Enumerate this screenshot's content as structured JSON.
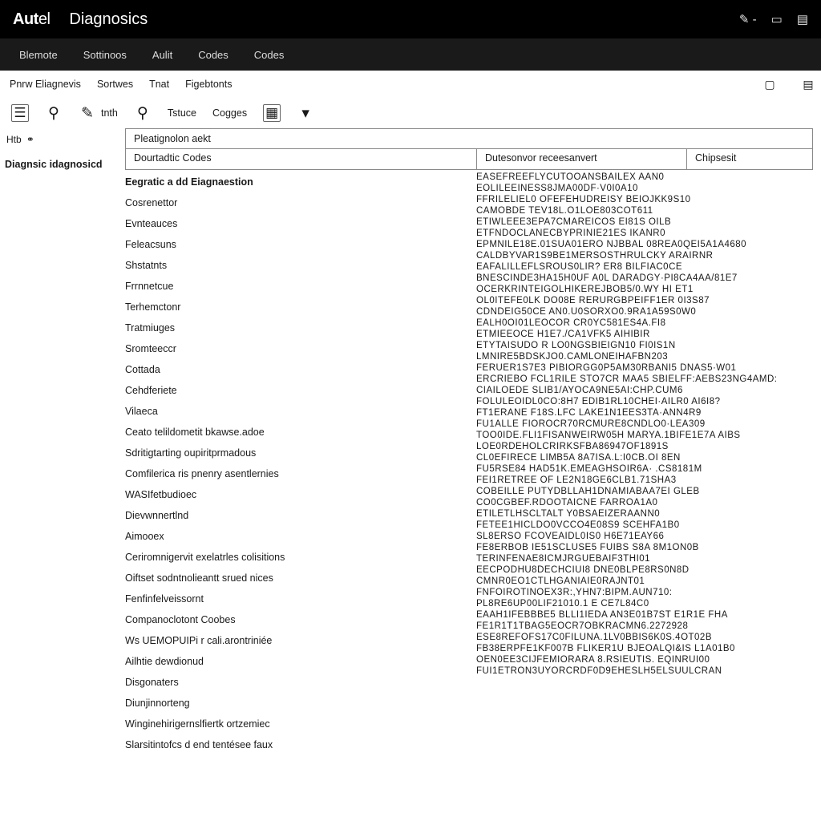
{
  "header": {
    "brand_bold": "Aut",
    "brand_light": "el",
    "title": "Diagnosics",
    "icons": [
      "✎ -",
      "▭",
      "▤"
    ]
  },
  "main_nav": [
    "Blemote",
    "Sottinoos",
    "Aulit",
    "Codes",
    "Codes"
  ],
  "sub_header": {
    "items": [
      "Pnrw Eliagnevis",
      "Sortwes",
      "Tnat",
      "Figebtonts"
    ],
    "right_icons": [
      "▢",
      "▤"
    ]
  },
  "toolbar": [
    {
      "icon": "☰",
      "label": "",
      "border": true
    },
    {
      "icon": "⚲",
      "label": "",
      "border": false
    },
    {
      "icon": "✎",
      "label": "tnth",
      "border": false
    },
    {
      "icon": "⚲",
      "label": "",
      "border": false
    },
    {
      "icon": "",
      "label": "Tstuce",
      "border": false
    },
    {
      "icon": "",
      "label": "Cogges",
      "border": false
    },
    {
      "icon": "▦",
      "label": "",
      "border": true
    },
    {
      "icon": "▾",
      "label": "",
      "border": false
    }
  ],
  "side": {
    "top_label": "Htb",
    "title": "Diagnsic idagnosicd"
  },
  "tab_strip": "Pleatignolon aekt",
  "columns": {
    "c1": "Dourtadtic Codes",
    "c2": "Dutesonvor receesanvert",
    "c3": "Chipsesit"
  },
  "left_rows": [
    {
      "t": "Eegratic a dd Eiagnaestion",
      "head": true
    },
    {
      "t": "Cosrenettor"
    },
    {
      "t": "Evnteauces"
    },
    {
      "t": "Feleacsuns"
    },
    {
      "t": "Shstatnts"
    },
    {
      "t": "Frrnnetcue"
    },
    {
      "t": "Terhemctonr"
    },
    {
      "t": "Tratmiuges"
    },
    {
      "t": "Sromteeccr"
    },
    {
      "t": "Cottada"
    },
    {
      "t": "Cehdferiete"
    },
    {
      "t": "Vilaeca"
    },
    {
      "t": "Ceato telildometit bkawse.adoe"
    },
    {
      "t": "Sdritigtarting oupiritprmadous"
    },
    {
      "t": "Comfilerica ris pnenry asentlernies"
    },
    {
      "t": "WASIfetbudioec"
    },
    {
      "t": "Dievwnnertlnd"
    },
    {
      "t": "Aimooex"
    },
    {
      "t": "Ceriromnigervit exelatrles colisitions"
    },
    {
      "t": "Oiftset sodntnolieantt srued nices"
    },
    {
      "t": "Fenfinfelveissornt"
    },
    {
      "t": "Companoclotont Coobes"
    },
    {
      "t": "Ws UEMOPUIPi r cali.arontriniée"
    },
    {
      "t": "Ailhtie dewdionud"
    },
    {
      "t": "Disgonaters"
    },
    {
      "t": "Diunjinnorteng"
    },
    {
      "t": "Winginehirigernslfiertk ortzemiec"
    },
    {
      "t": "Slarsitintofcs d end tentésee faux"
    }
  ],
  "right_rows": [
    "EASEFREEFLYCUTOOANSBAILEX AAN0",
    "EOLILEEINESS8JMA00DF·V0I0A10",
    "FFRILELIEL0 OFEFEHUDREISY BEIOJKK9S10",
    "CAMOBDE TEV18L.O1LOE803COT611",
    "ETIWLEEE3EPA7CMAREICOS EI81S OILB",
    "ETFNDOCLANECBYPRINIE21ES IKANR0",
    "EPMNILE18E.01SUA01ERO NJBBAL 08REA0QEI5A1A4680",
    "CALDBYVAR1S9BE1MERSOSTHRULCKY ARAIRNR",
    "EAFALILLEFLSROUS0LIR? ER8 BILFIAC0CE",
    "BNESCINDE3HA15H0UF A0L DARADGY·PI8CA4AA/81E7",
    "OCERKRINTEIGOLHIKEREJBOB5/0.WY HI ET1",
    "OL0ITEFE0LK DO08E RERURGBPEIFF1ER 0I3S87",
    "CDNDEIG50CE AN0.U0SORXO0.9RA1A59S0W0",
    "EALH0OI01LEOCOR CR0YC581ES4A.FI8",
    "ETMIEEOCE H1E7./CA1VFK5 AIHIBIR",
    "ETYTAISUDO R LO0NGSBIEIGN10 FI0IS1N",
    "LMNIRE5BDSKJO0.CAMLONEIHAFBN203",
    "FERUER1S7E3 PIBIORGG0P5AM30RBANI5 DNAS5·W01",
    "ERCRIEBO FCL1RILE STO7CR MAA5 SBIELFF:AEBS23NG4AMD:",
    "CIAILOEDE SLIB1/AYOCA9NE5AI:CHP.CUM6",
    "FOLULEOIDL0CO:8H7 EDIB1RL10CHEI·AILR0 AI6I8?",
    "FT1ERANE F18S.LFC LAKE1N1EES3TA·ANN4R9",
    "FU1ALLE FIOROCR70RCMURE8CNDLO0·LEA309",
    "TOO0IDE.FLI1FISANWEIRW05H MARYA.1BIFE1E7A AIBS",
    "LOE0RDEHOLCRIRKSFBA86947OF1891S",
    "CL0EFIRECE LIMB5A 8A7ISA.L:I0CB.OI 8EN",
    "FU5RSE84 HAD51K.EMEAGHSOIR6A· .CS8181M",
    "FEI1RETREE OF LE2N18GE6CLB1.71SHA3",
    "COBEILLE PUTYDBLLAH1DNAMIABAA7EI GLEB",
    "CO0CGBEF.RDOOTAICNE FARROA1A0",
    "ETILETLHSCLTALT Y0BSAEIZERAANN0",
    "FETEE1HICLDO0VCCO4E08S9 SCEHFA1B0",
    "SL8ERSO FCOVEAIDL0IS0 H6E71EAY66",
    "FE8ERBOB IE51SCLUSE5 FUIBS S8A 8M1ON0B",
    "TERINFENAE8ICMJRGUEBAIF3THI01",
    "EECPODHU8DECHCIUI8 DNE0BLPE8RS0N8D",
    "CMNR0EO1CTLHGANIAIE0RAJNT01",
    "FNFOIROTINOEX3R:,YHN7:BIPM.AUN710:",
    "PL8RE6UP00LIF21010.1 E CE7L84C0",
    "EAAH1IFEBBBE5 BlLI1IEDA AN3E01B7ST E1R1E  FHA",
    "FE1R1T1TBAG5EOCR7OBKRACMN6.2272928",
    "ESE8REFOFS17C0FILUNA.1LV0BBIS6K0S.4OT02B",
    "FB38ERPFE1KF007B FLIKER1U BJEOALQI&IS L1A01B0",
    "OEN0EE3CIJFEMIORARA 8.RSIEUTIS. EQINRUI00",
    "FUI1ETRON3UYORCRDF0D9EHESLH5ELSUULCRAN"
  ]
}
